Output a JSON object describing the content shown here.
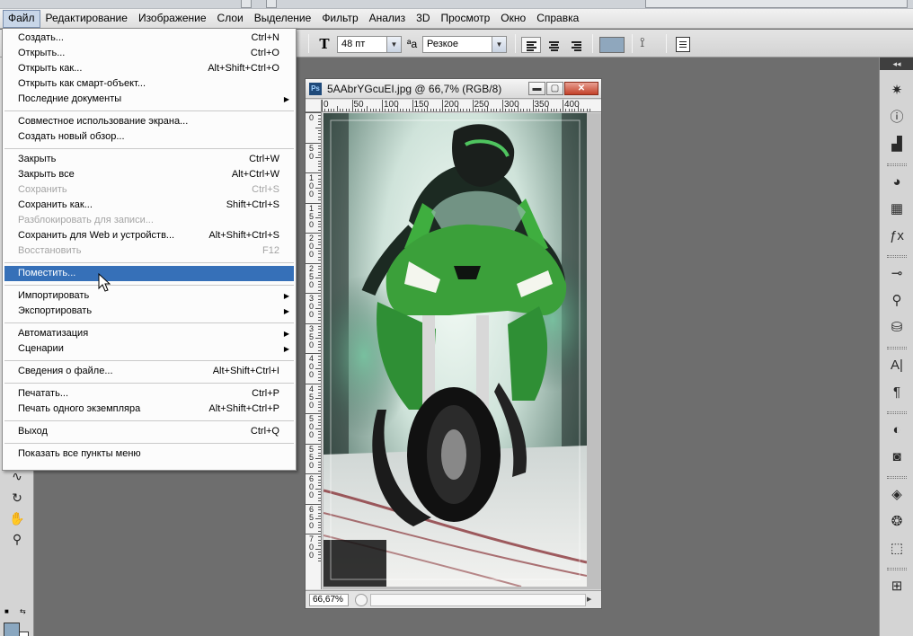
{
  "menubar": {
    "items": [
      "Файл",
      "Редактирование",
      "Изображение",
      "Слои",
      "Выделение",
      "Фильтр",
      "Анализ",
      "3D",
      "Просмотр",
      "Окно",
      "Справка"
    ],
    "active_index": 0
  },
  "options": {
    "text_tool_icon": "text-orientation-icon",
    "font_size": "48 пт",
    "aa_symbol": "ªa",
    "antialias": "Резкое",
    "text_color": "#8fa7bd"
  },
  "document": {
    "title": "5AAbrYGcuEI.jpg @ 66,7% (RGB/8)",
    "ps_badge": "Ps",
    "zoom": "66,67%",
    "ruler_h": [
      "0",
      "50",
      "100",
      "150",
      "200",
      "250",
      "300",
      "350",
      "400"
    ],
    "ruler_v": [
      "0",
      "5 0",
      "1 0 0",
      "1 5 0",
      "2 0 0",
      "2 5 0",
      "3 0 0",
      "3 5 0",
      "4 0 0",
      "4 5 0",
      "5 0 0",
      "5 5 0",
      "6 0 0",
      "6 5 0",
      "7 0 0"
    ]
  },
  "file_menu": {
    "groups": [
      [
        {
          "label": "Создать...",
          "shortcut": "Ctrl+N"
        },
        {
          "label": "Открыть...",
          "shortcut": "Ctrl+O"
        },
        {
          "label": "Открыть как...",
          "shortcut": "Alt+Shift+Ctrl+O"
        },
        {
          "label": "Открыть как смарт-объект...",
          "shortcut": ""
        },
        {
          "label": "Последние документы",
          "shortcut": "",
          "submenu": true
        }
      ],
      [
        {
          "label": "Совместное использование экрана...",
          "shortcut": ""
        },
        {
          "label": "Создать новый обзор...",
          "shortcut": ""
        }
      ],
      [
        {
          "label": "Закрыть",
          "shortcut": "Ctrl+W"
        },
        {
          "label": "Закрыть все",
          "shortcut": "Alt+Ctrl+W"
        },
        {
          "label": "Сохранить",
          "shortcut": "Ctrl+S",
          "disabled": true
        },
        {
          "label": "Сохранить как...",
          "shortcut": "Shift+Ctrl+S"
        },
        {
          "label": "Разблокировать для записи...",
          "shortcut": "",
          "disabled": true
        },
        {
          "label": "Сохранить для Web и устройств...",
          "shortcut": "Alt+Shift+Ctrl+S"
        },
        {
          "label": "Восстановить",
          "shortcut": "F12",
          "disabled": true
        }
      ],
      [
        {
          "label": "Поместить...",
          "shortcut": "",
          "highlighted": true
        }
      ],
      [
        {
          "label": "Импортировать",
          "shortcut": "",
          "submenu": true
        },
        {
          "label": "Экспортировать",
          "shortcut": "",
          "submenu": true
        }
      ],
      [
        {
          "label": "Автоматизация",
          "shortcut": "",
          "submenu": true
        },
        {
          "label": "Сценарии",
          "shortcut": "",
          "submenu": true
        }
      ],
      [
        {
          "label": "Сведения о файле...",
          "shortcut": "Alt+Shift+Ctrl+I"
        }
      ],
      [
        {
          "label": "Печатать...",
          "shortcut": "Ctrl+P"
        },
        {
          "label": "Печать одного экземпляра",
          "shortcut": "Alt+Shift+Ctrl+P"
        }
      ],
      [
        {
          "label": "Выход",
          "shortcut": "Ctrl+Q"
        }
      ],
      [
        {
          "label": "Показать все пункты меню",
          "shortcut": ""
        }
      ]
    ]
  },
  "right_panel": {
    "collapse_label": "◂◂",
    "icons": [
      {
        "name": "navigator-icon",
        "glyph": "✷"
      },
      {
        "name": "info-icon",
        "glyph": "ⓘ"
      },
      {
        "name": "histogram-icon",
        "glyph": "▟"
      },
      {
        "name": "color-palette-icon",
        "glyph": "◕"
      },
      {
        "name": "swatches-icon",
        "glyph": "▦"
      },
      {
        "name": "styles-fx-icon",
        "glyph": "ƒx"
      },
      {
        "name": "brushes-icon",
        "glyph": "⊸"
      },
      {
        "name": "clone-source-icon",
        "glyph": "⚲"
      },
      {
        "name": "tool-presets-icon",
        "glyph": "⛁"
      },
      {
        "name": "character-icon",
        "glyph": "A|"
      },
      {
        "name": "paragraph-icon",
        "glyph": "¶"
      },
      {
        "name": "adjustments-icon",
        "glyph": "◐"
      },
      {
        "name": "masks-icon",
        "glyph": "◙"
      },
      {
        "name": "layers-icon",
        "glyph": "◈"
      },
      {
        "name": "channels-icon",
        "glyph": "❂"
      },
      {
        "name": "paths-icon",
        "glyph": "⬚"
      },
      {
        "name": "actions-icon",
        "glyph": "⊞"
      }
    ]
  },
  "left_tools": {
    "icons": [
      {
        "name": "lasso-tool-icon",
        "glyph": "∿"
      },
      {
        "name": "rotate-view-icon",
        "glyph": "↻"
      },
      {
        "name": "hand-tool-icon",
        "glyph": "✋"
      },
      {
        "name": "zoom-tool-icon",
        "glyph": "⚲"
      }
    ],
    "swap_symbol": "⇆",
    "fg_color": "#8aa7c0",
    "bg_color": "#ffffff"
  }
}
